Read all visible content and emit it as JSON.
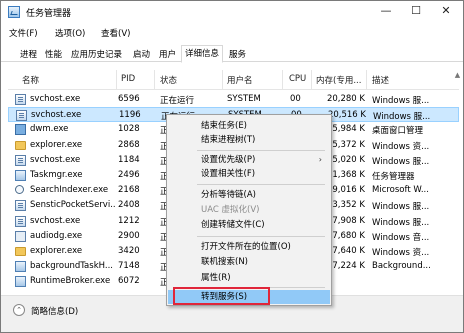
{
  "window": {
    "title": "任务管理器",
    "controls": {
      "minimize": "—",
      "maximize": "☐",
      "close": "✕"
    }
  },
  "menubar": [
    "文件(F)",
    "选项(O)",
    "查看(V)"
  ],
  "tabs": [
    "进程",
    "性能",
    "应用历史记录",
    "启动",
    "用户",
    "详细信息",
    "服务"
  ],
  "active_tab": "详细信息",
  "table": {
    "columns": [
      "名称",
      "PID",
      "状态",
      "用户名",
      "CPU",
      "内存(专用...",
      "描述"
    ],
    "rows": [
      {
        "name": "svchost.exe",
        "pid": "6596",
        "status": "正在运行",
        "user": "SYSTEM",
        "cpu": "00",
        "mem": "20,280 K",
        "desc": "Windows 服...",
        "icon": "service-icon"
      },
      {
        "name": "svchost.exe",
        "pid": "1196",
        "status": "正在运行",
        "user": "SYSTEM",
        "cpu": "00",
        "mem": "20,516 K",
        "desc": "Windows 服...",
        "icon": "service-icon"
      },
      {
        "name": "dwm.exe",
        "pid": "1028",
        "status": "正在",
        "user": "",
        "cpu": "",
        "mem": "5,984 K",
        "desc": "桌面窗口管理",
        "icon": "monitor-icon"
      },
      {
        "name": "explorer.exe",
        "pid": "2868",
        "status": "正在",
        "user": "",
        "cpu": "",
        "mem": "5,372 K",
        "desc": "Windows 资...",
        "icon": "folder-icon"
      },
      {
        "name": "svchost.exe",
        "pid": "1184",
        "status": "正在",
        "user": "",
        "cpu": "",
        "mem": "5,020 K",
        "desc": "Windows 服...",
        "icon": "service-icon"
      },
      {
        "name": "Taskmgr.exe",
        "pid": "2496",
        "status": "正在",
        "user": "",
        "cpu": "",
        "mem": "1,368 K",
        "desc": "任务管理器",
        "icon": "taskmgr-icon"
      },
      {
        "name": "SearchIndexer.exe",
        "pid": "2168",
        "status": "正在",
        "user": "",
        "cpu": "",
        "mem": "9,016 K",
        "desc": "Microsoft W...",
        "icon": "search-icon"
      },
      {
        "name": "SensticPocketServi...",
        "pid": "2408",
        "status": "正在",
        "user": "",
        "cpu": "",
        "mem": "3,352 K",
        "desc": "Windows 服...",
        "icon": "service-icon"
      },
      {
        "name": "svchost.exe",
        "pid": "1212",
        "status": "正在",
        "user": "",
        "cpu": "",
        "mem": "7,908 K",
        "desc": "Windows 服...",
        "icon": "service-icon"
      },
      {
        "name": "audiodg.exe",
        "pid": "2900",
        "status": "正在",
        "user": "",
        "cpu": "",
        "mem": "7,680 K",
        "desc": "Windows 音...",
        "icon": "speaker-icon"
      },
      {
        "name": "explorer.exe",
        "pid": "3420",
        "status": "正在",
        "user": "",
        "cpu": "",
        "mem": "7,640 K",
        "desc": "Windows 资...",
        "icon": "folder-icon"
      },
      {
        "name": "backgroundTaskH...",
        "pid": "7148",
        "status": "正在",
        "user": "",
        "cpu": "",
        "mem": "7,224 K",
        "desc": "Background...",
        "icon": "app-icon"
      },
      {
        "name": "RuntimeBroker.exe",
        "pid": "6072",
        "status": "正在",
        "user": "",
        "cpu": "",
        "mem": "",
        "desc": "",
        "icon": "app-icon"
      }
    ]
  },
  "context_menu": {
    "items": [
      {
        "label": "结束任务(E)",
        "disabled": false,
        "submenu": false
      },
      {
        "label": "结束进程树(T)",
        "disabled": false,
        "submenu": false
      },
      {
        "label": "设置优先级(P)",
        "disabled": false,
        "submenu": true
      },
      {
        "label": "设置相关性(F)",
        "disabled": false,
        "submenu": false
      },
      {
        "label": "分析等待链(A)",
        "disabled": false,
        "submenu": false
      },
      {
        "label": "UAC 虚拟化(V)",
        "disabled": true,
        "submenu": false
      },
      {
        "label": "创建转储文件(C)",
        "disabled": false,
        "submenu": false
      },
      {
        "label": "打开文件所在的位置(O)",
        "disabled": false,
        "submenu": false
      },
      {
        "label": "联机搜索(N)",
        "disabled": false,
        "submenu": false
      },
      {
        "label": "属性(R)",
        "disabled": false,
        "submenu": false
      },
      {
        "label": "转到服务(S)",
        "disabled": false,
        "submenu": false,
        "hover": true
      }
    ]
  },
  "footer": {
    "label": "简略信息(D)",
    "icon": "chevron-up-icon"
  },
  "colors": {
    "selection": "#cce8ff",
    "menu_hover": "#91c9f7",
    "highlight_box": "#e0263a"
  }
}
